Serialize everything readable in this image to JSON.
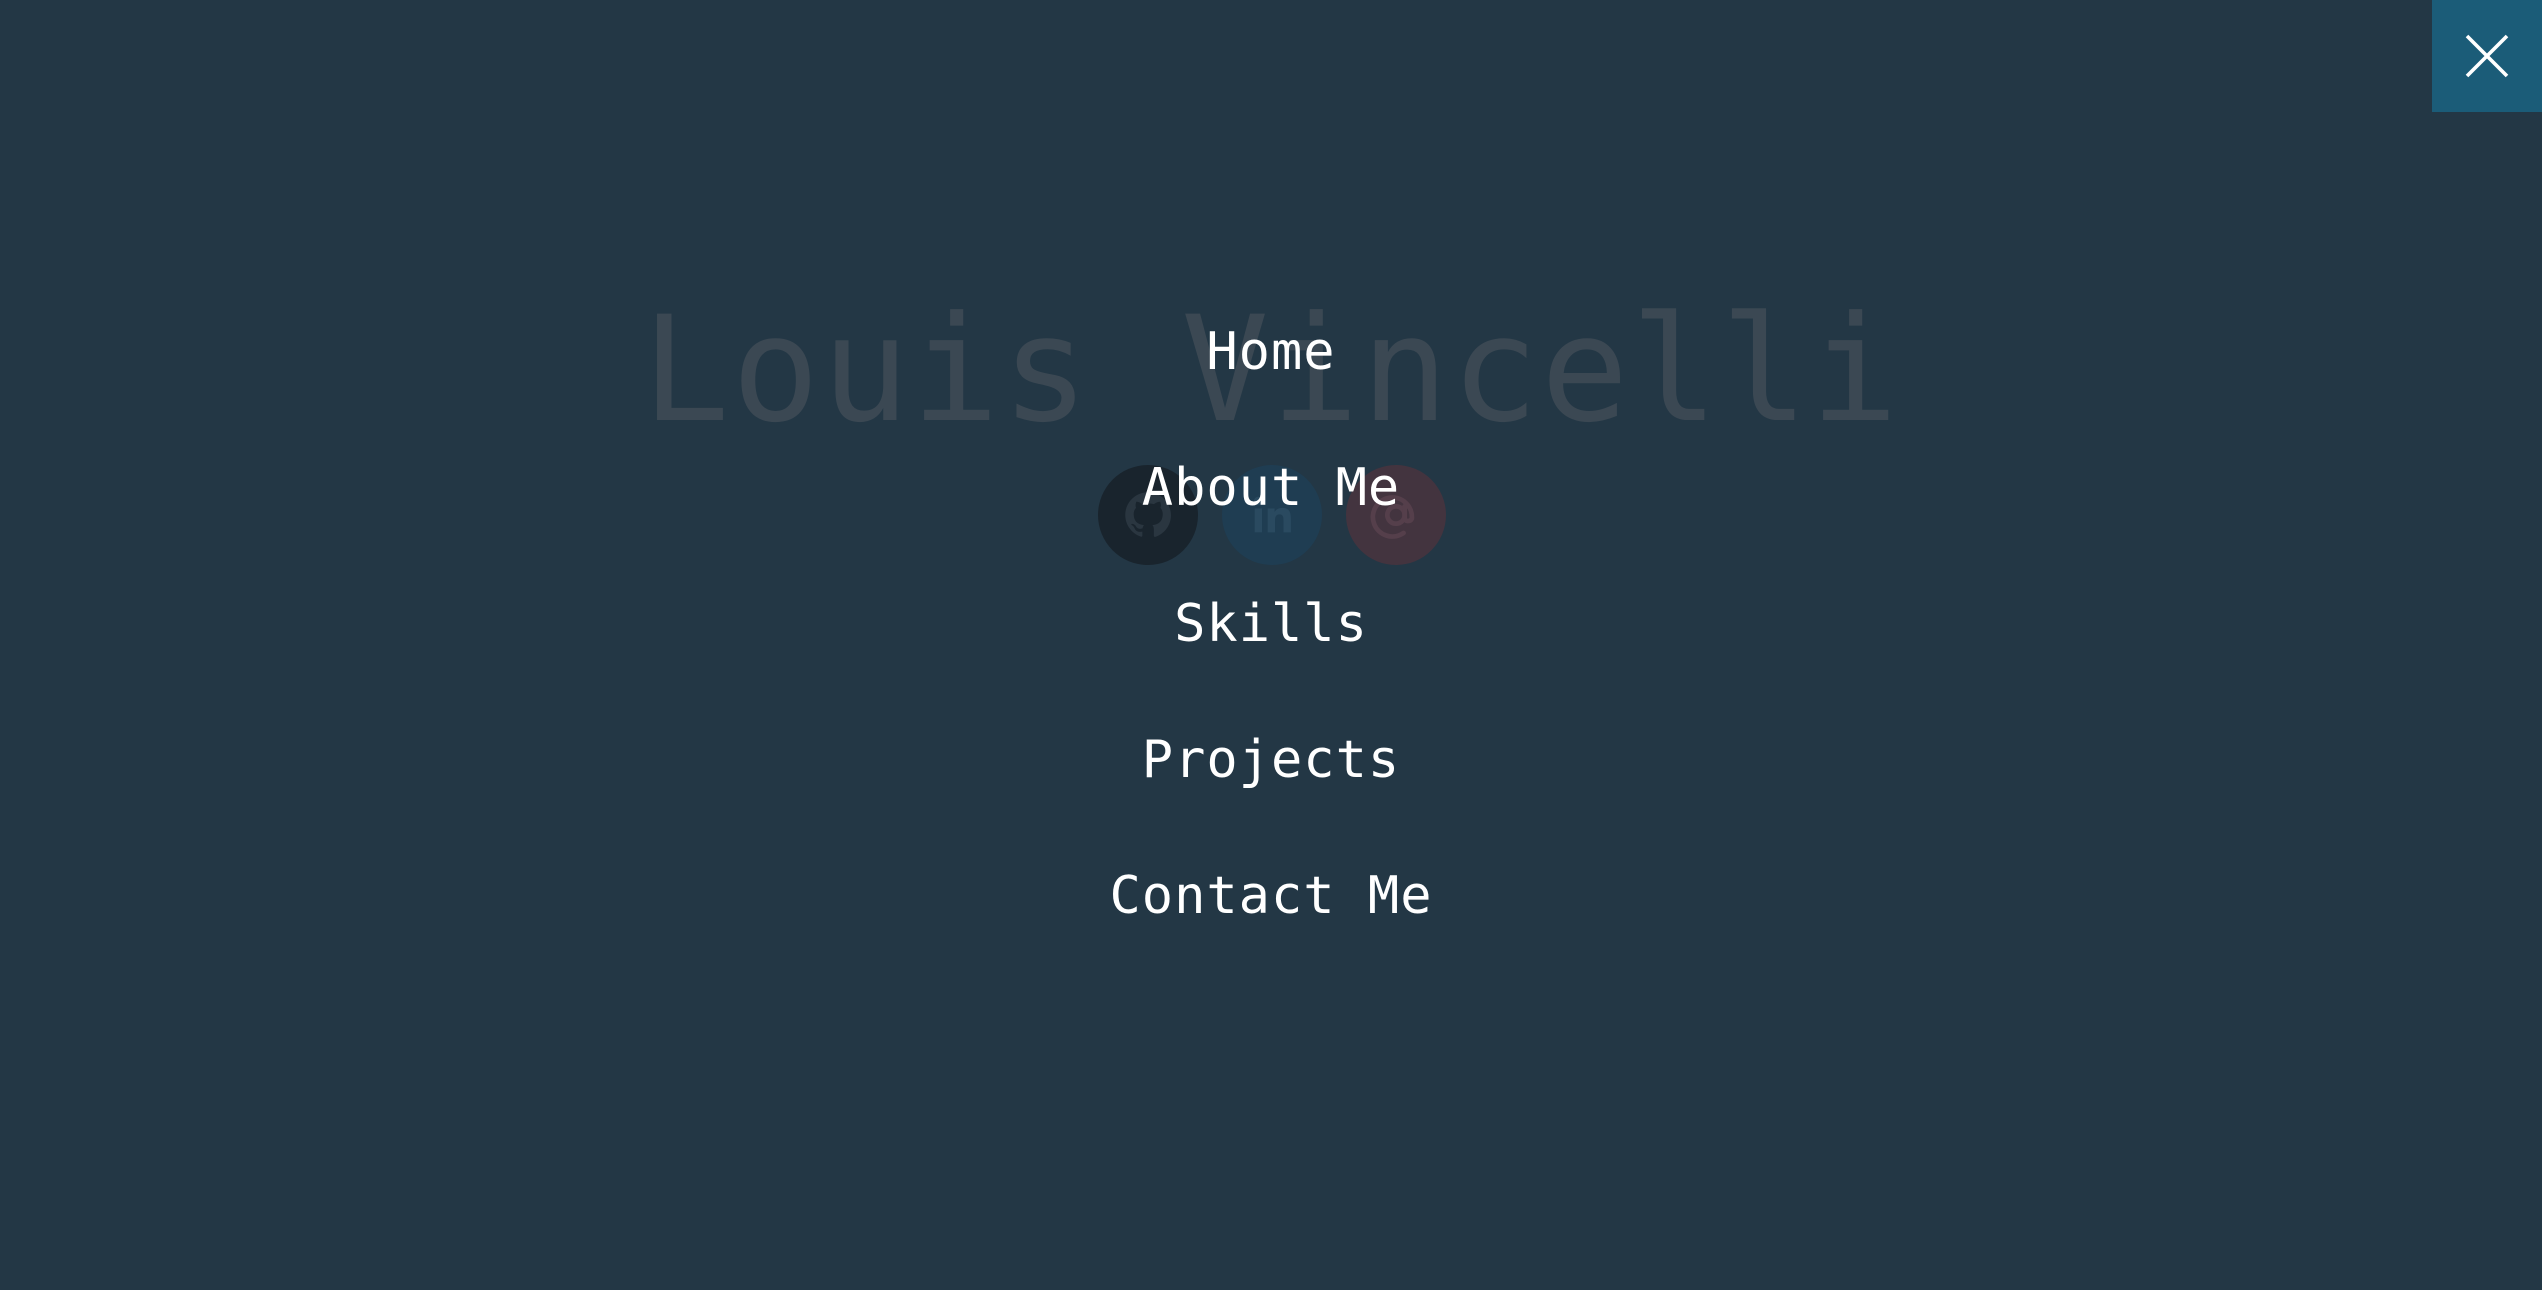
{
  "hero": {
    "name": "Louis Vincelli",
    "socials": [
      {
        "icon": "github-icon"
      },
      {
        "icon": "linkedin-icon"
      },
      {
        "icon": "email-icon"
      }
    ]
  },
  "menu": {
    "items": [
      {
        "label": "Home"
      },
      {
        "label": "About Me"
      },
      {
        "label": "Skills"
      },
      {
        "label": "Projects"
      },
      {
        "label": "Contact Me"
      }
    ],
    "close_icon": "close-icon"
  },
  "colors": {
    "background": "#233745",
    "close_button": "#1b5c78",
    "menu_text": "#ffffff",
    "dimmed_name": "#3b4853"
  }
}
